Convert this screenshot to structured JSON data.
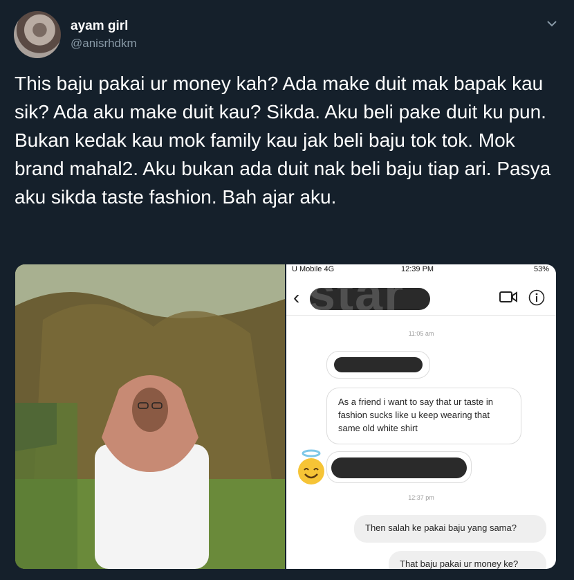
{
  "tweet": {
    "author": {
      "display_name": "ayam girl",
      "handle": "@anisrhdkm"
    },
    "text": "This baju pakai ur money kah? Ada make duit mak bapak kau sik? Ada aku make duit kau? Sikda. Aku beli pake duit ku pun. Bukan kedak kau mok family kau jak beli baju tok tok. Mok brand mahal2. Aku bukan ada duit nak beli baju tiap ari. Pasya aku sikda taste fashion. Bah ajar aku.",
    "menu_icon": "chevron-down-icon"
  },
  "chat_screenshot": {
    "status_bar": {
      "carrier": "U Mobile 4G",
      "time": "12:39 PM",
      "battery": "53%"
    },
    "messages": {
      "timestamp_1": "11:05 am",
      "received_text": "As a friend i want to say that ur taste in fashion sucks like u keep wearing that same old white shirt",
      "timestamp_2": "12:37 pm",
      "sent_1": "Then salah ke pakai baju yang sama?",
      "sent_2": "That baju pakai ur money ke?"
    },
    "watermark": "star"
  },
  "colors": {
    "background": "#15202b",
    "text": "#ffffff",
    "secondary": "#8899a6"
  }
}
